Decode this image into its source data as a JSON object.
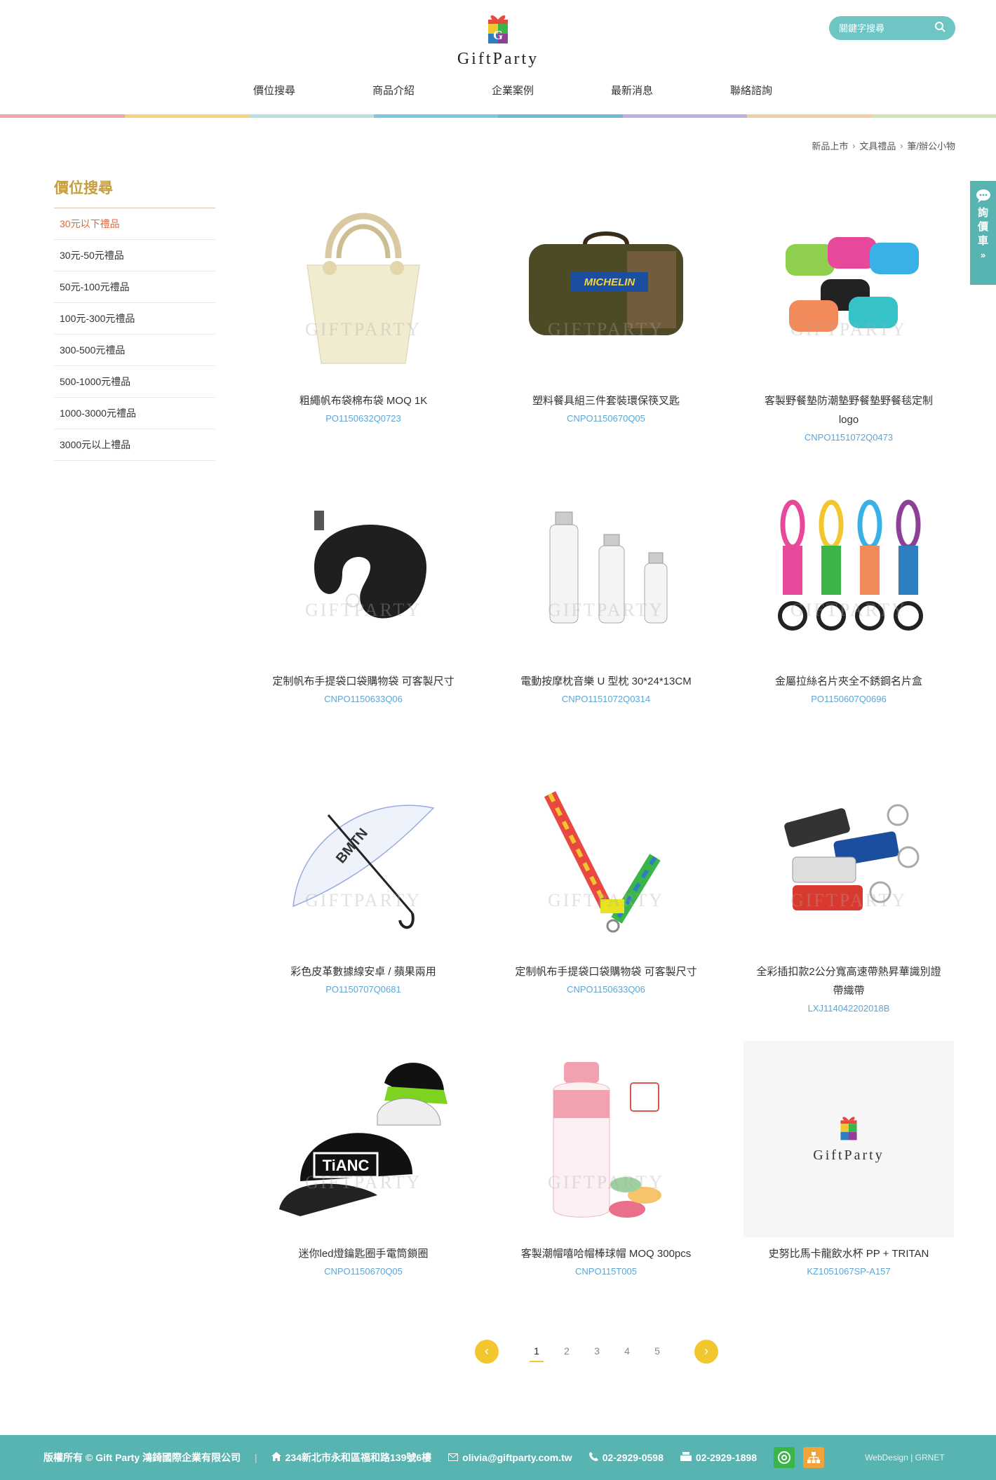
{
  "header": {
    "logo_text": "GiftParty",
    "search_placeholder": "關鍵字搜尋",
    "nav": [
      "價位搜尋",
      "商品介紹",
      "企業案例",
      "最新消息",
      "聯絡諮詢"
    ]
  },
  "breadcrumb": [
    "新品上市",
    "文具禮品",
    "筆/辦公小物"
  ],
  "sidebar": {
    "title": "價位搜尋",
    "items": [
      "30元以下禮品",
      "30元-50元禮品",
      "50元-100元禮品",
      "100元-300元禮品",
      "300-500元禮品",
      "500-1000元禮品",
      "1000-3000元禮品",
      "3000元以上禮品"
    ]
  },
  "products": [
    {
      "name": "粗繩帆布袋棉布袋 MOQ 1K",
      "code": "PO1150632Q0723"
    },
    {
      "name": "塑料餐具組三件套裝環保筷叉匙",
      "code": "CNPO1150670Q05"
    },
    {
      "name": "客製野餐墊防潮墊野餐墊野餐毯定制logo",
      "code": "CNPO1151072Q0473"
    },
    {
      "name": "定制帆布手提袋口袋購物袋 可客製尺寸",
      "code": "CNPO1150633Q06"
    },
    {
      "name": "電動按摩枕音樂 U 型枕 30*24*13CM",
      "code": "CNPO1151072Q0314"
    },
    {
      "name": "金屬拉絲名片夾全不銹鋼名片盒",
      "code": "PO1150607Q0696"
    },
    {
      "name": "彩色皮革數據線安卓 / 蘋果兩用",
      "code": "PO1150707Q0681"
    },
    {
      "name": "定制帆布手提袋口袋購物袋 可客製尺寸",
      "code": "CNPO1150633Q06"
    },
    {
      "name": "全彩插扣款2公分寬高速帶熱昇華識別證帶織帶",
      "code": "LXJ114042202018B"
    },
    {
      "name": "迷你led燈鑰匙圈手電筒鎖圈",
      "code": "CNPO1150670Q05"
    },
    {
      "name": "客製潮帽嘻哈帽棒球帽 MOQ 300pcs",
      "code": "CNPO115T005"
    },
    {
      "name": "史努比馬卡龍飲水杯 PP + TRITAN",
      "code": "KZ1051067SP-A157"
    }
  ],
  "watermark": "GIFTPARTY",
  "pagination": {
    "prev": "‹",
    "next": "›",
    "pages": [
      "1",
      "2",
      "3",
      "4",
      "5"
    ],
    "current": "1"
  },
  "side_tab": [
    "詢",
    "價",
    "車",
    "»"
  ],
  "footer": {
    "copyright": "版權所有 © Gift Party 鴻錡國際企業有限公司",
    "address": "234新北市永和區福和路139號6樓",
    "email": "olivia@giftparty.com.tw",
    "phone": "02-2929-0598",
    "fax": "02-2929-1898",
    "credits": "WebDesign | GRNET"
  },
  "colors": {
    "teal": "#58b4b1",
    "gold": "#c89d3c",
    "active_orange": "#e1683a",
    "code_blue": "#5ba6d6",
    "yellow": "#f2c62f"
  }
}
